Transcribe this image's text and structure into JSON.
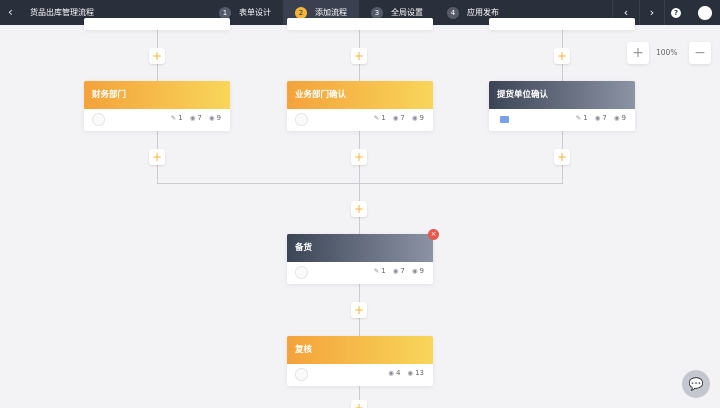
{
  "topbar": {
    "back_icon": "chevron-left-icon",
    "title": "货品出库管理流程",
    "steps": [
      {
        "num": "1",
        "label": "表单设计"
      },
      {
        "num": "2",
        "label": "添加流程"
      },
      {
        "num": "3",
        "label": "全局设置"
      },
      {
        "num": "4",
        "label": "应用发布"
      }
    ],
    "active_step": 2,
    "accent_color": "#f5b53a"
  },
  "zoom": {
    "level": "100%",
    "plus": "+",
    "minus": "−"
  },
  "nodes": {
    "finance": {
      "title": "财务部门",
      "edit": "1",
      "view": "7",
      "see": "9"
    },
    "business": {
      "title": "业务部门确认",
      "edit": "1",
      "view": "7",
      "see": "9"
    },
    "pickup": {
      "title": "提货单位确认",
      "edit": "1",
      "view": "7",
      "see": "9"
    },
    "prepare": {
      "title": "备货",
      "edit": "1",
      "view": "7",
      "see": "9"
    },
    "review": {
      "title": "复核",
      "view": "4",
      "see": "13"
    }
  },
  "add_symbol": "+",
  "close_symbol": "×"
}
